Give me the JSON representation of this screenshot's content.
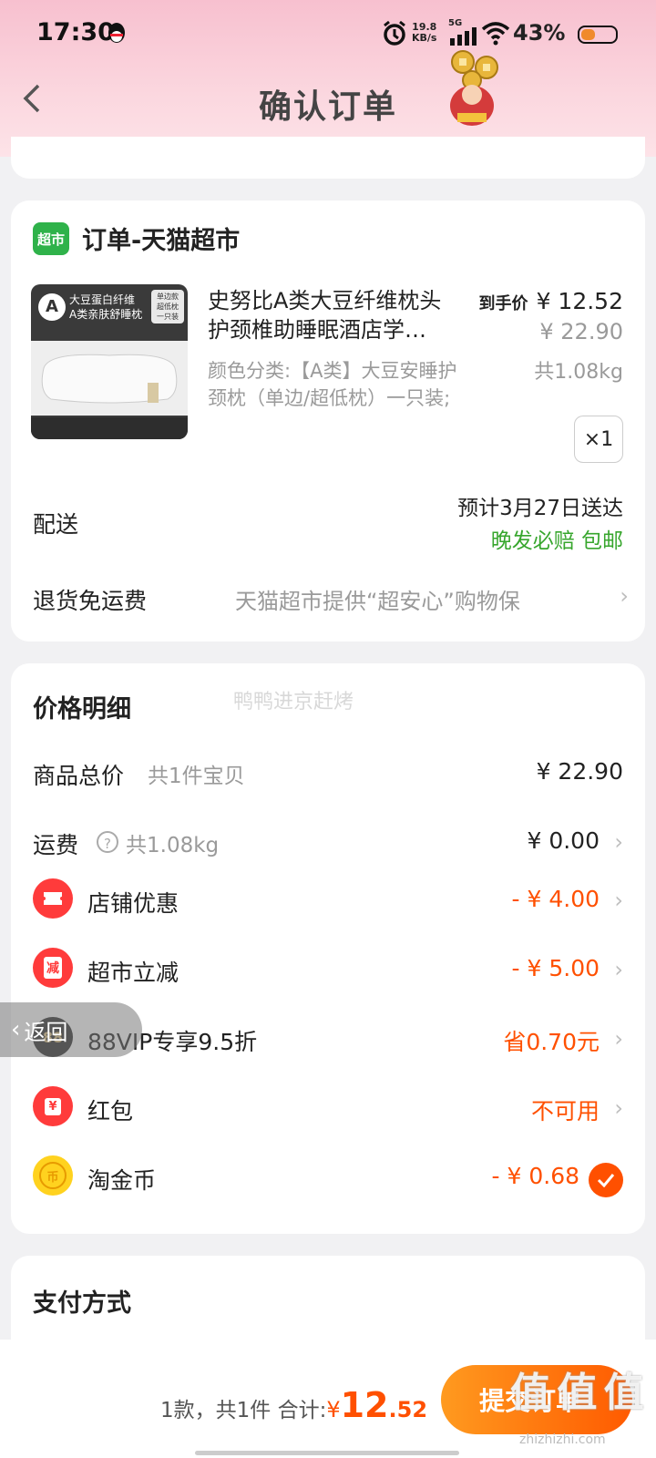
{
  "status": {
    "time": "17:30",
    "speed_top": "19.8",
    "speed_unit": "KB/s",
    "net": "5G",
    "battery": "43%",
    "battery_level": 0.43
  },
  "header": {
    "title": "确认订单"
  },
  "order": {
    "store_badge": "超市",
    "store_title": "订单-天猫超市",
    "product": {
      "thumb_title": "大豆蛋白纤维",
      "thumb_sub": "A类亲肤舒睡枕",
      "thumb_tag1": "单边款",
      "thumb_tag2": "超低枕",
      "thumb_tag3": "一只装",
      "thumb_a": "A",
      "name_line1": "史努比A类大豆纤维枕头",
      "name_line2": "护颈椎助睡眠酒店学…",
      "price_label": "到手价",
      "price": "¥ 12.52",
      "orig_price": "¥ 22.90",
      "spec_line1": "颜色分类:【A类】大豆安睡护",
      "spec_line2": "颈枕（单边/超低枕）一只装;",
      "weight": "共1.08kg",
      "qty": "×1"
    },
    "delivery": {
      "label": "配送",
      "eta": "预计3月27日送达",
      "guarantee": "晚发必赔 包邮"
    },
    "return": {
      "label": "退货免运费",
      "text": "天猫超市提供“超安心”购物保"
    }
  },
  "price_detail": {
    "title": "价格明细",
    "watermark": "鸭鸭进京赶烤",
    "goods": {
      "label": "商品总价",
      "sub": "共1件宝贝",
      "value": "¥ 22.90"
    },
    "shipping": {
      "label": "运费",
      "sub": "共1.08kg",
      "value": "¥ 0.00"
    },
    "shop_discount": {
      "label": "店铺优惠",
      "value": "- ¥ 4.00"
    },
    "market_cut": {
      "label": "超市立减",
      "value": "- ¥ 5.00",
      "icon_text": "减"
    },
    "vip": {
      "label": "88VIP专享9.5折",
      "value": "省0.70元",
      "icon_text": "88"
    },
    "redpacket": {
      "label": "红包",
      "value": "不可用",
      "icon_text": "¥"
    },
    "coins": {
      "label": "淘金币",
      "value": "- ¥ 0.68",
      "icon_text": "币"
    }
  },
  "payment": {
    "title": "支付方式"
  },
  "float_back": {
    "label": "返回"
  },
  "bottom": {
    "summary": "1款，共1件 合计:",
    "currency": "¥",
    "total_int": "12",
    "total_dec": ".52",
    "submit": "提交订单",
    "watermark": "值 值 值",
    "watermark_url": "zhizhizhi.com"
  },
  "colors": {
    "accent": "#ff5000",
    "green": "#37a62d",
    "header_pink": "#f7c0cf"
  }
}
